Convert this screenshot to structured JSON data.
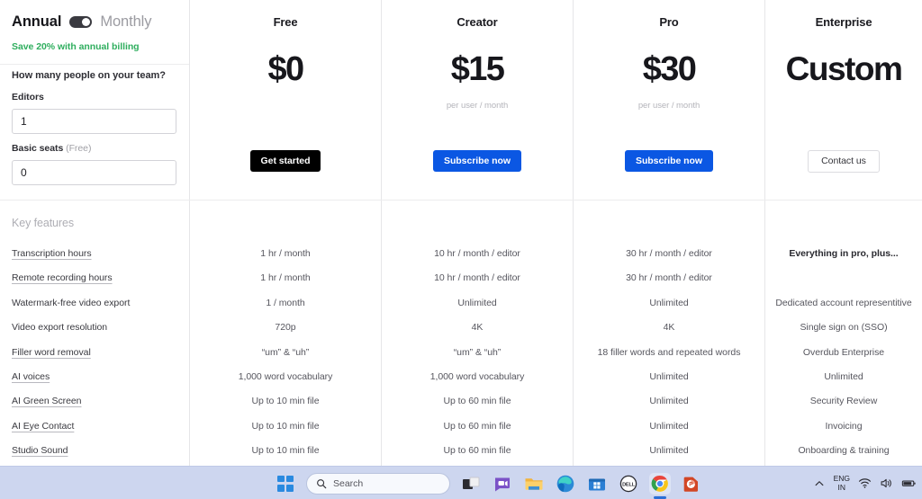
{
  "sidebar": {
    "billing": {
      "annual_label": "Annual",
      "monthly_label": "Monthly",
      "toggle_name": "billing-period-toggle",
      "active": "Annual",
      "save_note": "Save 20% with annual billing",
      "save_note_color": "#2fae5e"
    },
    "form": {
      "question": "How many people on your team?",
      "editors_label": "Editors",
      "editors_value": "1",
      "basic_seats_label": "Basic seats",
      "basic_seats_suffix": "(Free)",
      "basic_seats_value": "0"
    },
    "key_features_title": "Key features",
    "features": [
      {
        "label": "Transcription hours",
        "underlined": true
      },
      {
        "label": "Remote recording hours",
        "underlined": true
      },
      {
        "label": "Watermark-free video export",
        "underlined": false
      },
      {
        "label": "Video export resolution",
        "underlined": false
      },
      {
        "label": "Filler word removal",
        "underlined": true
      },
      {
        "label": "AI voices",
        "underlined": true
      },
      {
        "label": "AI Green Screen",
        "underlined": true
      },
      {
        "label": "AI Eye Contact",
        "underlined": true
      },
      {
        "label": "Studio Sound",
        "underlined": true
      }
    ]
  },
  "plans": [
    {
      "name": "Free",
      "price": "$0",
      "period": "",
      "cta_label": "Get started",
      "cta_style": "dark",
      "cta_color": "#000000",
      "values": [
        "1 hr / month",
        "1 hr / month",
        "1 / month",
        "720p",
        "“um” & “uh”",
        "1,000 word vocabulary",
        "Up to 10 min file",
        "Up to 10 min file",
        "Up to 10 min file"
      ],
      "bold_rows": []
    },
    {
      "name": "Creator",
      "price": "$15",
      "period": "per user / month",
      "cta_label": "Subscribe now",
      "cta_style": "blue",
      "cta_color": "#0b57e3",
      "values": [
        "10 hr / month / editor",
        "10 hr / month / editor",
        "Unlimited",
        "4K",
        "“um” & “uh”",
        "1,000 word vocabulary",
        "Up to 60 min file",
        "Up to 60 min file",
        "Up to 60 min file"
      ],
      "bold_rows": []
    },
    {
      "name": "Pro",
      "price": "$30",
      "period": "per user / month",
      "cta_label": "Subscribe now",
      "cta_style": "blue",
      "cta_color": "#0b57e3",
      "values": [
        "30 hr / month / editor",
        "30 hr / month / editor",
        "Unlimited",
        "4K",
        "18 filler words and repeated words",
        "Unlimited",
        "Unlimited",
        "Unlimited",
        "Unlimited"
      ],
      "bold_rows": []
    },
    {
      "name": "Enterprise",
      "price": "Custom",
      "period": "",
      "cta_label": "Contact us",
      "cta_style": "ghost",
      "cta_color": "#ffffff",
      "values": [
        "Everything in pro, plus...",
        "",
        "Dedicated account representitive",
        "Single sign on (SSO)",
        "Overdub Enterprise",
        "Unlimited",
        "Security Review",
        "Invoicing",
        "Onboarding & training"
      ],
      "bold_rows": [
        0
      ]
    }
  ],
  "taskbar": {
    "start_label": "Start",
    "search_placeholder": "Search",
    "apps": [
      {
        "name": "task-view",
        "label": "Task View"
      },
      {
        "name": "chat-teams",
        "label": "Chat"
      },
      {
        "name": "file-explorer",
        "label": "File Explorer"
      },
      {
        "name": "microsoft-edge",
        "label": "Microsoft Edge"
      },
      {
        "name": "microsoft-store",
        "label": "Microsoft Store"
      },
      {
        "name": "dell",
        "label": "Dell"
      },
      {
        "name": "google-chrome",
        "label": "Google Chrome",
        "active": true
      },
      {
        "name": "powerpoint",
        "label": "PowerPoint"
      }
    ],
    "tray": {
      "overflow_label": "Show hidden icons",
      "language_line1": "ENG",
      "language_line2": "IN",
      "wifi_label": "Network",
      "volume_label": "Volume",
      "battery_label": "Battery"
    }
  }
}
